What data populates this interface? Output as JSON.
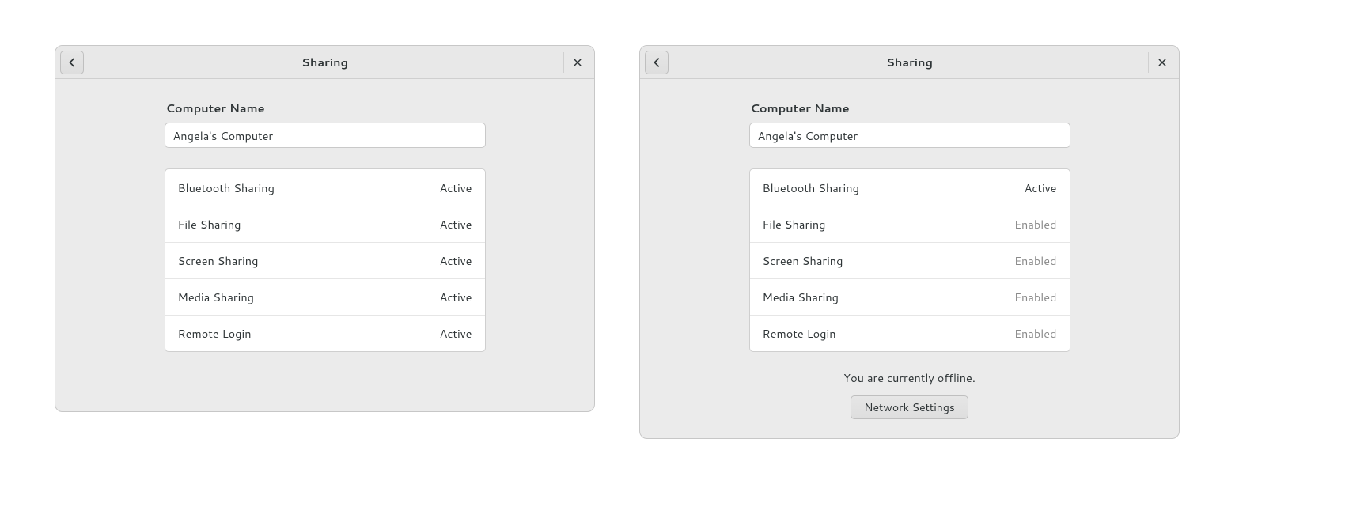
{
  "windows": [
    {
      "id": "online",
      "title": "Sharing",
      "computer_name_label": "Computer Name",
      "computer_name_value": "Angela's Computer",
      "rows": [
        {
          "label": "Bluetooth Sharing",
          "status": "Active",
          "dim": false
        },
        {
          "label": "File Sharing",
          "status": "Active",
          "dim": false
        },
        {
          "label": "Screen Sharing",
          "status": "Active",
          "dim": false
        },
        {
          "label": "Media Sharing",
          "status": "Active",
          "dim": false
        },
        {
          "label": "Remote Login",
          "status": "Active",
          "dim": false
        }
      ],
      "offline": null
    },
    {
      "id": "offline",
      "title": "Sharing",
      "computer_name_label": "Computer Name",
      "computer_name_value": "Angela's Computer",
      "rows": [
        {
          "label": "Bluetooth Sharing",
          "status": "Active",
          "dim": false
        },
        {
          "label": "File Sharing",
          "status": "Enabled",
          "dim": true
        },
        {
          "label": "Screen Sharing",
          "status": "Enabled",
          "dim": true
        },
        {
          "label": "Media Sharing",
          "status": "Enabled",
          "dim": true
        },
        {
          "label": "Remote Login",
          "status": "Enabled",
          "dim": true
        }
      ],
      "offline": {
        "message": "You are currently offline.",
        "button": "Network Settings"
      }
    }
  ]
}
